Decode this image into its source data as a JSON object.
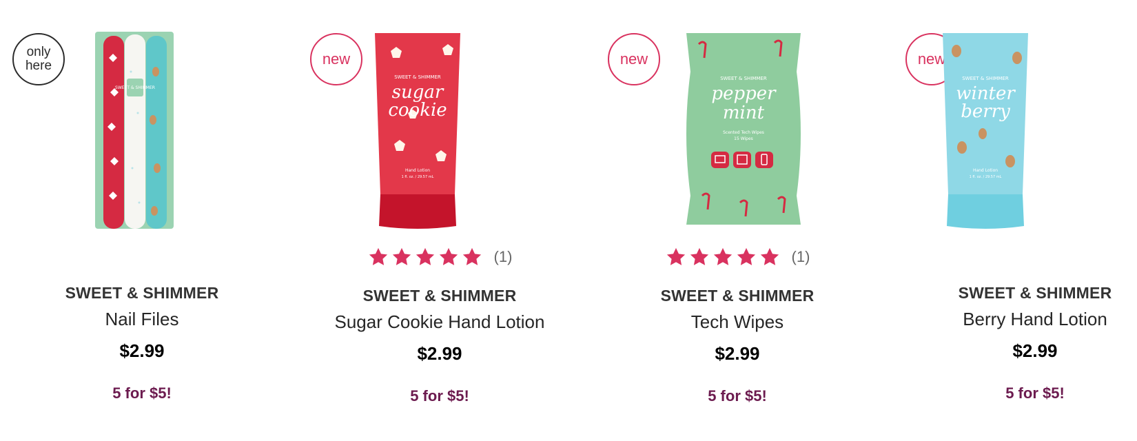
{
  "products": [
    {
      "badge": "only\nhere",
      "brand": "SWEET & SHIMMER",
      "name": "Nail Files",
      "price": "$2.99",
      "promo": "5 for $5!",
      "image_text": [
        "SWEET & SHIMMER"
      ]
    },
    {
      "badge": "new",
      "brand": "SWEET & SHIMMER",
      "name": "Sugar Cookie Hand Lotion",
      "price": "$2.99",
      "promo": "5 for $5!",
      "rating_count": "(1)",
      "rating_value": 5,
      "image_text": [
        "SWEET & SHIMMER",
        "sugar",
        "cookie",
        "Hand Lotion",
        "1 fl. oz. / 29.57 mL"
      ]
    },
    {
      "badge": "new",
      "brand": "SWEET & SHIMMER",
      "name": "Tech Wipes",
      "price": "$2.99",
      "promo": "5 for $5!",
      "rating_count": "(1)",
      "rating_value": 5,
      "image_text": [
        "SWEET & SHIMMER",
        "pepper",
        "mint",
        "Scented Tech Wipes",
        "15 Wipes"
      ]
    },
    {
      "badge": "new",
      "brand": "SWEET & SHIMMER",
      "name": "Berry Hand Lotion",
      "price": "$2.99",
      "promo": "5 for $5!",
      "image_text": [
        "SWEET & SHIMMER",
        "winter",
        "berry",
        "Hand Lotion",
        "1 fl. oz. / 29.57 mL"
      ]
    }
  ],
  "colors": {
    "badge_new": "#d9325f",
    "star": "#d9325f",
    "promo": "#6c1b4f"
  },
  "icons": {
    "star": "star-icon"
  }
}
